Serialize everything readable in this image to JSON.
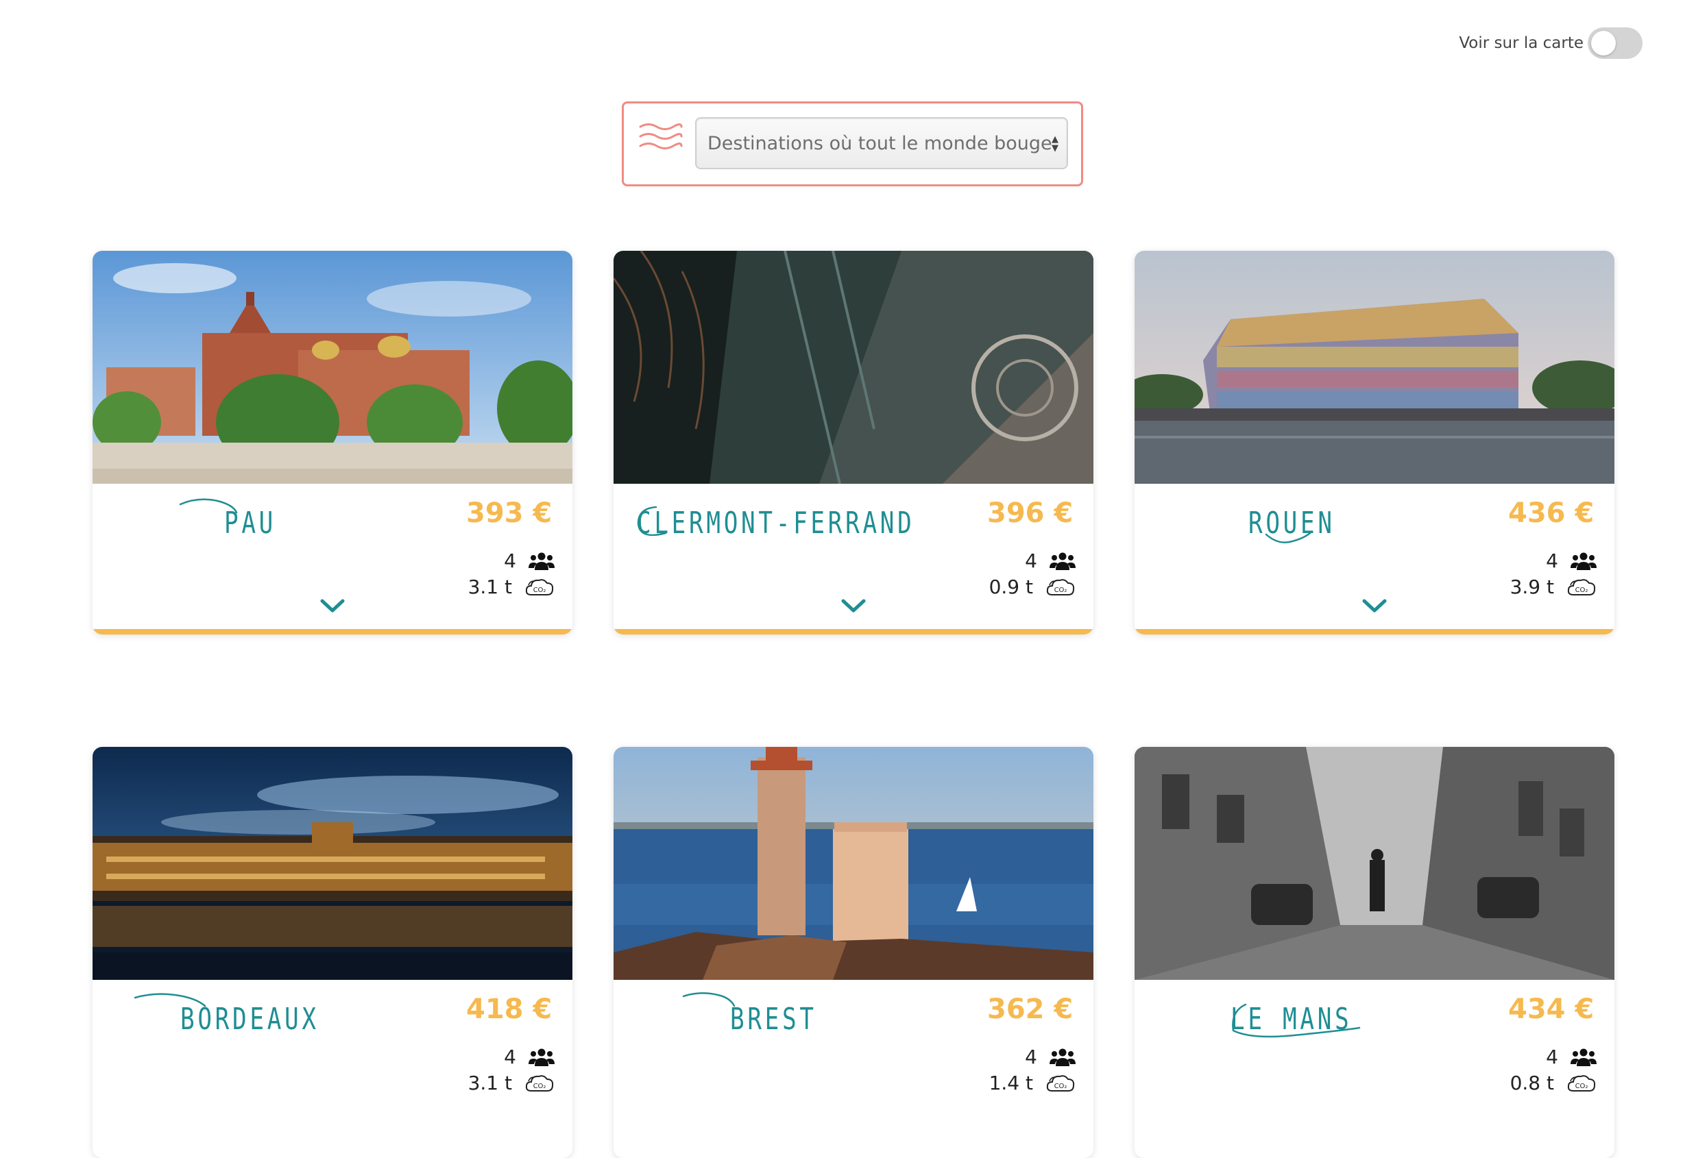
{
  "map_toggle": {
    "label": "Voir sur la carte",
    "enabled": false
  },
  "filter": {
    "selected": "Destinations où tout le monde bouge"
  },
  "colors": {
    "accent_teal": "#1f8e93",
    "price_orange": "#f6b94f",
    "filter_border": "#ef8b83"
  },
  "icons": {
    "people": "users-group-icon",
    "co2": "co2-cloud-icon",
    "expand": "chevron-down-icon"
  },
  "cards": [
    {
      "city": "PAU",
      "price": "393 €",
      "people": "4",
      "co2": "3.1 t"
    },
    {
      "city": "CLERMONT-FERRAND",
      "price": "396 €",
      "people": "4",
      "co2": "0.9 t"
    },
    {
      "city": "ROUEN",
      "price": "436 €",
      "people": "4",
      "co2": "3.9 t"
    },
    {
      "city": "BORDEAUX",
      "price": "418 €",
      "people": "4",
      "co2": "3.1 t"
    },
    {
      "city": "BREST",
      "price": "362 €",
      "people": "4",
      "co2": "1.4 t"
    },
    {
      "city": "LE MANS",
      "price": "434 €",
      "people": "4",
      "co2": "0.8 t"
    }
  ]
}
